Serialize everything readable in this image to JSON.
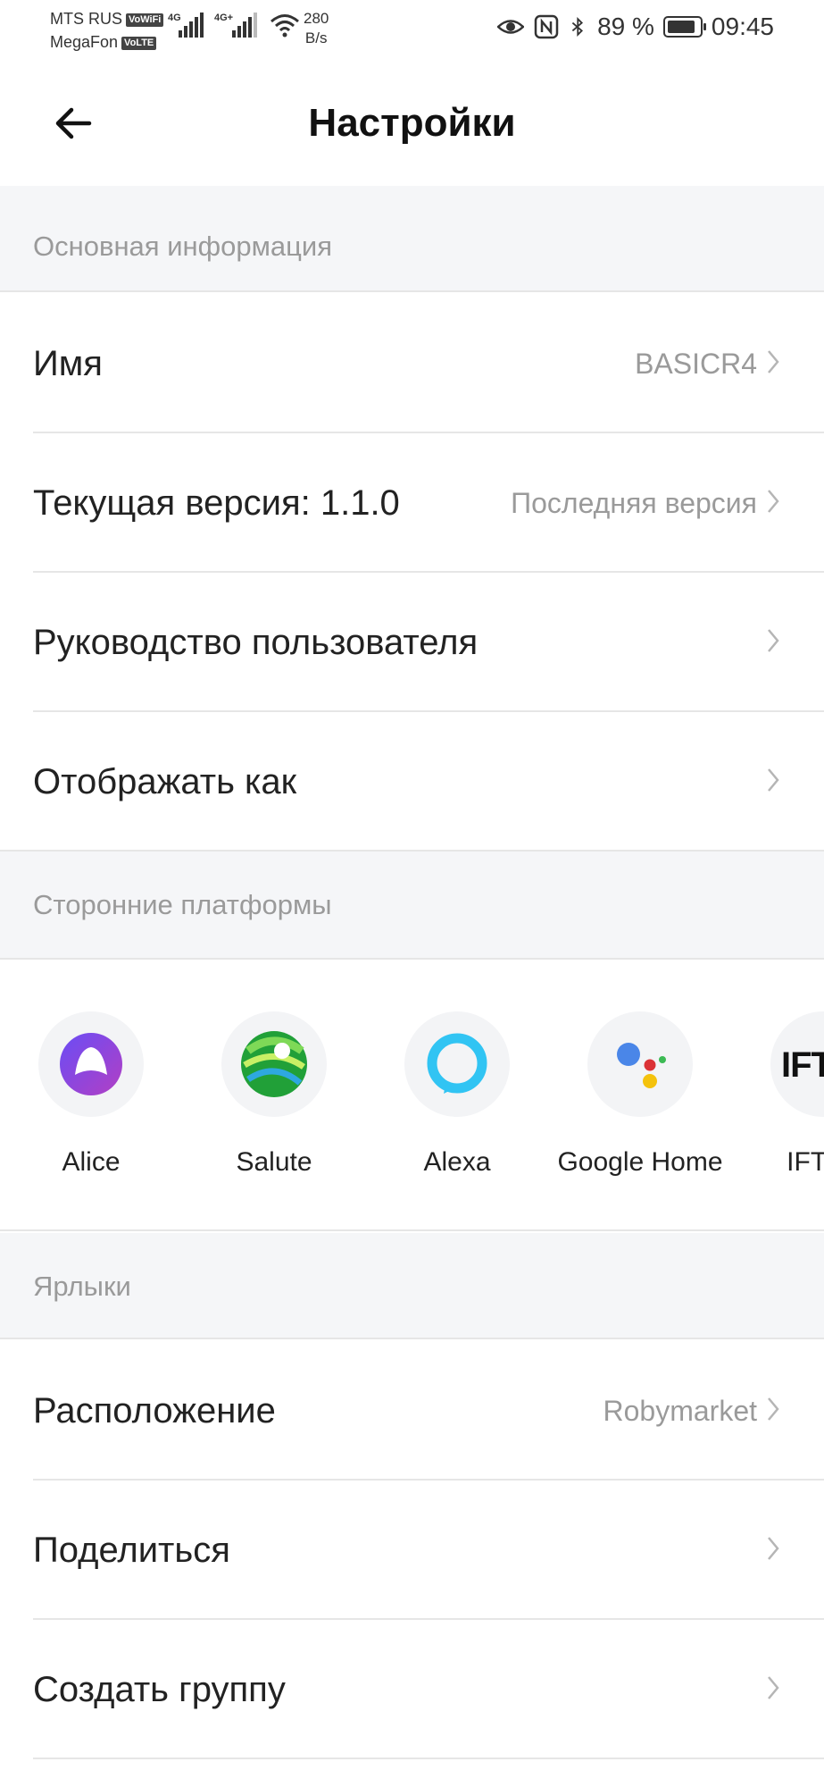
{
  "status_bar": {
    "carrier1": "MTS RUS",
    "carrier1_badge": "VoWiFi",
    "carrier2": "MegaFon",
    "carrier2_badge": "VoLTE",
    "sig1_label": "4G",
    "sig2_label": "4G+",
    "speed_value": "280",
    "speed_unit": "B/s",
    "battery_pct": 89,
    "battery_text": "89 %",
    "time": "09:45"
  },
  "header": {
    "title": "Настройки"
  },
  "sections": {
    "basic": {
      "title": "Основная информация",
      "name_label": "Имя",
      "name_value": "BASICR4",
      "version_label": "Текущая версия:  1.1.0",
      "version_value": "Последняя версия",
      "manual_label": "Руководство пользователя",
      "display_label": "Отображать как"
    },
    "third_party": {
      "title": "Сторонние платформы",
      "platforms": [
        {
          "name": "Alice",
          "icon": "alice-icon"
        },
        {
          "name": "Salute",
          "icon": "salute-icon"
        },
        {
          "name": "Alexa",
          "icon": "alexa-icon"
        },
        {
          "name": "Google Home",
          "icon": "google-home-icon"
        },
        {
          "name": "IFTTT",
          "icon": "ifttt-icon"
        }
      ],
      "ifttt_logo_text": "IFTTT"
    },
    "shortcuts": {
      "title": "Ярлыки",
      "location_label": "Расположение",
      "location_value": "Robymarket",
      "share_label": "Поделиться",
      "group_label": "Создать группу"
    }
  },
  "colors": {
    "section_bg": "#f5f6f8",
    "secondary_text": "#9a9a9a",
    "divider": "#e6e6e6"
  }
}
